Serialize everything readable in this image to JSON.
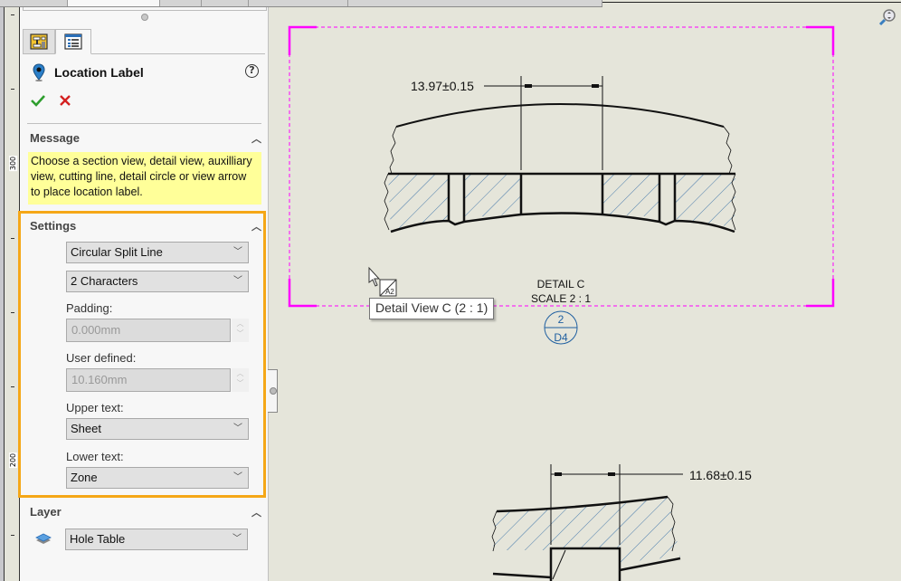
{
  "panel": {
    "title": "Location Label",
    "help_icon": "help-icon",
    "ok_icon": "checkmark-icon",
    "cancel_icon": "close-icon",
    "tabs": [
      {
        "name": "tab-feature-manager",
        "icon": "property-icon"
      },
      {
        "name": "tab-property-manager",
        "icon": "list-icon"
      }
    ],
    "message": {
      "heading": "Message",
      "text": "Choose a section view, detail view, auxilliary view, cutting line, detail circle or view arrow to place location label."
    },
    "settings": {
      "heading": "Settings",
      "style_select": "Circular Split Line",
      "chars_select": "2 Characters",
      "padding_label": "Padding:",
      "padding_value": "0.000mm",
      "user_defined_label": "User defined:",
      "user_defined_value": "10.160mm",
      "upper_text_label": "Upper text:",
      "upper_text_value": "Sheet",
      "lower_text_label": "Lower text:",
      "lower_text_value": "Zone"
    },
    "layer": {
      "heading": "Layer",
      "value": "Hole Table"
    }
  },
  "ruler": {
    "labels": [
      "300",
      "200"
    ]
  },
  "drawing": {
    "dim_top": "13.97±0.15",
    "dim_bottom": "11.68±0.15",
    "detail_label": "DETAIL C",
    "scale_label": "SCALE 2 : 1",
    "location_label_upper": "2",
    "location_label_lower": "D4",
    "cursor_badge": "A2",
    "tooltip": "Detail View C (2 : 1)",
    "colors": {
      "view_border": "#ff00ff",
      "hatch": "#1f5fa0",
      "label": "#1f5fa0",
      "highlight": "#f5a717",
      "message_bg": "#ffff99"
    }
  }
}
